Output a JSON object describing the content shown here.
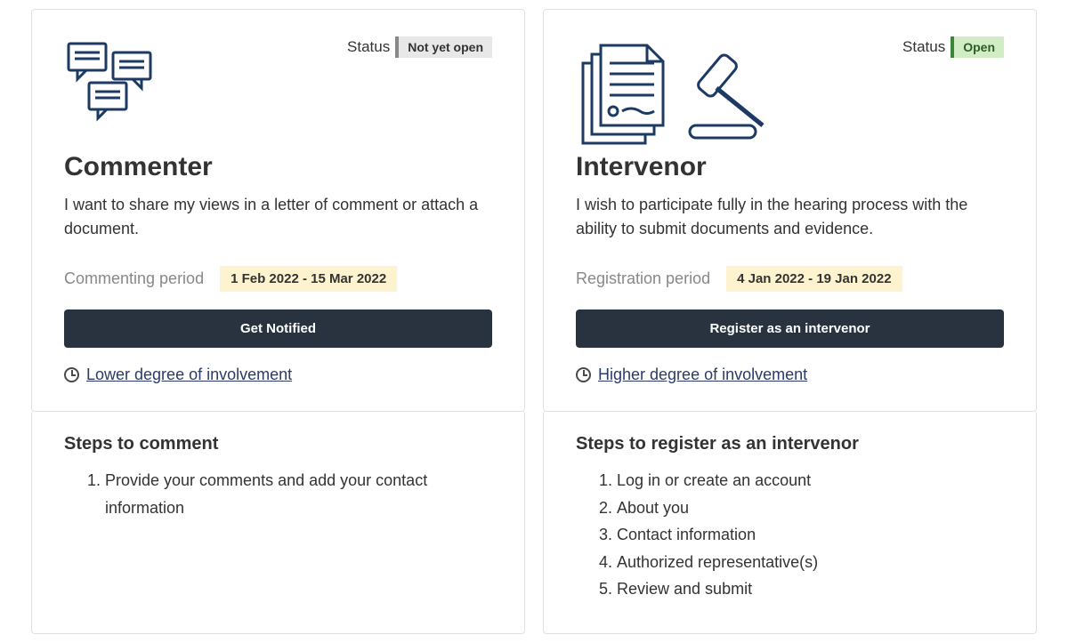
{
  "status_label": "Status",
  "commenter": {
    "status": "Not yet open",
    "title": "Commenter",
    "description": "I want to share my views in a letter of comment or attach a document.",
    "period_label": "Commenting period",
    "period_range": "1 Feb 2022 - 15 Mar 2022",
    "button": "Get Notified",
    "involvement": "Lower degree of involvement",
    "steps_title": "Steps to comment",
    "steps": [
      "Provide your comments and add your contact information"
    ]
  },
  "intervenor": {
    "status": "Open",
    "title": "Intervenor",
    "description": "I wish to participate fully in the hearing process with the ability to submit documents and evidence.",
    "period_label": "Registration period",
    "period_range": "4 Jan 2022 - 19 Jan 2022",
    "button": "Register as an intervenor",
    "involvement": "Higher degree of involvement",
    "steps_title": "Steps to register as an intervenor",
    "steps": [
      "Log in or create an account",
      "About you",
      "Contact information",
      "Authorized representative(s)",
      "Review and submit"
    ]
  }
}
